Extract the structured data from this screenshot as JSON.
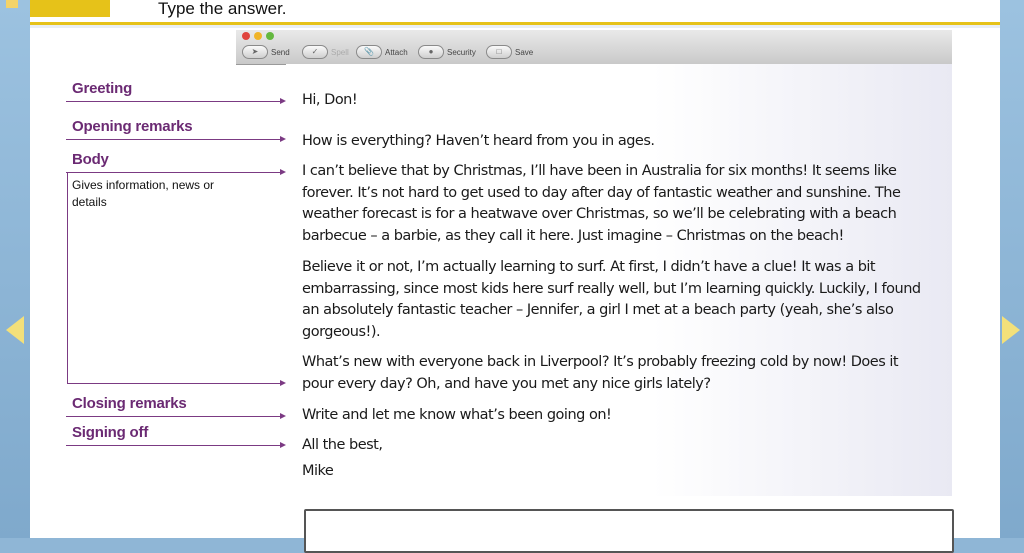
{
  "header": {
    "instruction": "Type the answer."
  },
  "toolbar": {
    "items": [
      {
        "name": "send",
        "label": "Send"
      },
      {
        "name": "spell",
        "label": "Spell"
      },
      {
        "name": "attach",
        "label": "Attach"
      },
      {
        "name": "security",
        "label": "Security"
      },
      {
        "name": "save",
        "label": "Save"
      }
    ]
  },
  "labels": {
    "greeting": "Greeting",
    "opening": "Opening remarks",
    "body": "Body",
    "body_note": "Gives information, news or details",
    "closing": "Closing remarks",
    "signing": "Signing off"
  },
  "email": {
    "greeting": "Hi, Don!",
    "opening": "How is everything? Haven’t heard from you in ages.",
    "body1": "I can’t believe that by Christmas, I’ll have been in Australia for six months! It seems like forever.  It’s not hard to get used to day after day of fantastic weather and sunshine. The weather forecast is for a heatwave over Christmas, so we’ll be celebrating with a beach barbecue – a barbie, as they call it here. Just imagine – Christmas on the beach!",
    "body2": "Believe it or not, I’m actually learning to surf. At first, I didn’t have a clue! It was a bit embarrassing, since most kids here surf really well, but I’m learning quickly. Luckily, I found an absolutely fantastic teacher – Jennifer, a girl I met at a beach party (yeah, she’s also gorgeous!).",
    "body3": "What’s new with everyone back in Liverpool? It’s probably freezing cold by now! Does it pour every day? Oh, and have you met any nice girls lately?",
    "closing": "Write and let me know what’s been going on!",
    "signoff": "All the best,",
    "signature": "Mike"
  },
  "colors": {
    "accent": "#e6c219",
    "label": "#6b2a73",
    "frame": "#8fb6d6"
  }
}
